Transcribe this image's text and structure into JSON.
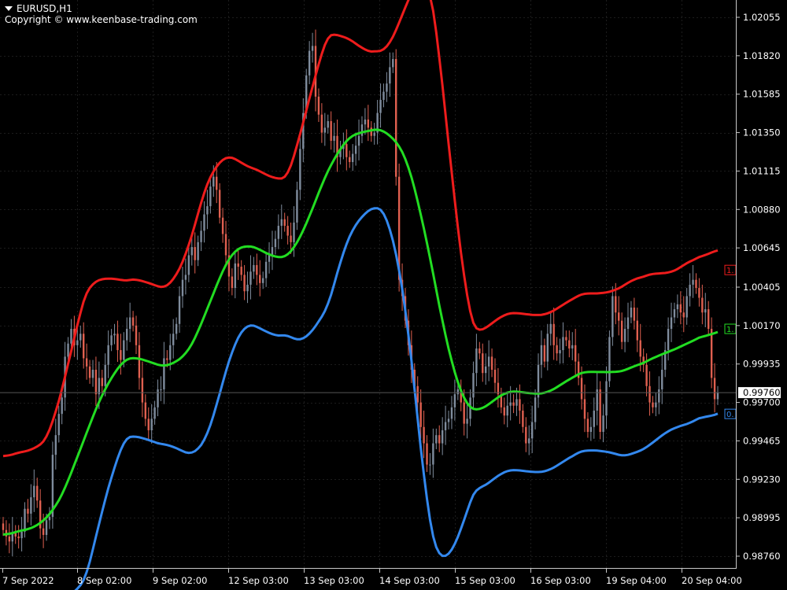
{
  "header": {
    "symbol": "EURUSD,H1",
    "copyright": "Copyright © www.keenbase-trading.com"
  },
  "colors": {
    "background": "#000000",
    "grid": "#1c1c1c",
    "axis": "#c8c8c8",
    "text": "#ffffff",
    "bull": "#7f8c9d",
    "bear": "#e06050",
    "upper_band": "#ee1c1c",
    "middle_band": "#22dd22",
    "lower_band": "#3388ee"
  },
  "chart_data": {
    "type": "candlestick",
    "title": "EURUSD,H1",
    "price_axis": {
      "ticks": [
        "1.02055",
        "1.01820",
        "1.01585",
        "1.01350",
        "1.01115",
        "1.00880",
        "1.00645",
        "1.00405",
        "1.00170",
        "0.99935",
        "0.99700",
        "0.99465",
        "0.99230",
        "0.98995",
        "0.98760"
      ],
      "range": [
        0.9865,
        1.0215
      ],
      "current_price": "0.99760"
    },
    "time_axis": {
      "labels": [
        "7 Sep 2022",
        "8 Sep 02:00",
        "9 Sep 02:00",
        "12 Sep 03:00",
        "13 Sep 03:00",
        "14 Sep 03:00",
        "15 Sep 03:00",
        "16 Sep 03:00",
        "19 Sep 04:00",
        "20 Sep 04:00"
      ]
    },
    "grid": true,
    "right_tags": [
      {
        "series": "upper",
        "text": "1.",
        "value": 1.0051
      },
      {
        "series": "middle",
        "text": "1.",
        "value": 1.0015
      },
      {
        "series": "lower",
        "text": "0.",
        "value": 0.9963
      }
    ],
    "close": [
      0.9892,
      0.9888,
      0.9885,
      0.989,
      0.9888,
      0.9887,
      0.9891,
      0.9905,
      0.9902,
      0.9912,
      0.9919,
      0.991,
      0.9893,
      0.9889,
      0.9898,
      0.99,
      0.9938,
      0.995,
      0.9963,
      0.9973,
      0.9998,
      1.0006,
      1.0015,
      1.0005,
      1.0008,
      1.0012,
      0.9997,
      0.9992,
      0.9985,
      0.999,
      0.9975,
      0.9985,
      0.998,
      0.9993,
      1.0005,
      1.0011,
      1.0012,
      1.0002,
      0.9996,
      1.0008,
      1.0015,
      1.0022,
      1.0017,
      1.0005,
      0.9985,
      0.997,
      0.996,
      0.9953,
      0.996,
      0.9967,
      0.9978,
      0.9978,
      0.9997,
      0.9996,
      1.0005,
      1.0012,
      1.0018,
      1.0035,
      1.0045,
      1.0048,
      1.006,
      1.0065,
      1.0057,
      1.0068,
      1.0075,
      1.0085,
      1.009,
      1.0102,
      1.0108,
      1.01,
      1.0083,
      1.0073,
      1.006,
      1.0047,
      1.004,
      1.0055,
      1.0053,
      1.0048,
      1.0038,
      1.0042,
      1.005,
      1.0054,
      1.0048,
      1.0043,
      1.0046,
      1.0056,
      1.006,
      1.0065,
      1.007,
      1.0078,
      1.0082,
      1.0078,
      1.0072,
      1.0068,
      1.008,
      1.01,
      1.0125,
      1.0147,
      1.017,
      1.0185,
      1.0188,
      1.0157,
      1.0146,
      1.0135,
      1.0138,
      1.0142,
      1.013,
      1.0133,
      1.012,
      1.0125,
      1.0128,
      1.012,
      1.0117,
      1.0122,
      1.0127,
      1.0133,
      1.014,
      1.0143,
      1.0138,
      1.0133,
      1.0135,
      1.0147,
      1.0155,
      1.016,
      1.0165,
      1.0175,
      1.018,
      1.0108,
      1.0045,
      1.0035,
      1.002,
      1.0005,
      0.999,
      0.998,
      0.997,
      0.9955,
      0.9945,
      0.9932,
      0.9932,
      0.9945,
      0.995,
      0.9945,
      0.9953,
      0.9958,
      0.996,
      0.9967,
      0.9975,
      0.9978,
      0.997,
      0.9957,
      0.996,
      0.9973,
      0.9988,
      1.0003,
      1.0,
      0.9988,
      0.9992,
      0.9998,
      0.999,
      0.9982,
      0.9975,
      0.9967,
      0.9962,
      0.9968,
      0.997,
      0.9968,
      0.9972,
      0.9965,
      0.9955,
      0.9945,
      0.9948,
      0.9958,
      0.9973,
      0.9993,
      1.0005,
      0.9995,
      1.0012,
      1.0018,
      1.0005,
      1.0,
      1.0002,
      1.001,
      1.0008,
      1.0003,
      1.0005,
      0.9995,
      0.9985,
      0.9972,
      0.996,
      0.9952,
      0.9955,
      0.9965,
      0.9978,
      0.9952,
      0.9962,
      0.9983,
      1.001,
      1.0035,
      1.0025,
      1.002,
      1.0007,
      1.0015,
      1.0022,
      1.0028,
      1.002,
      1.0008,
      0.9998,
      0.9993,
      0.998,
      0.997,
      0.9967,
      0.997,
      0.9978,
      0.999,
      1.0002,
      1.0015,
      1.0022,
      1.0027,
      1.003,
      1.0025,
      1.0022,
      1.0035,
      1.0042,
      1.0045,
      1.004,
      1.0034,
      1.0025,
      1.0027,
      1.0015,
      0.9985,
      0.9972,
      0.9976
    ]
  }
}
